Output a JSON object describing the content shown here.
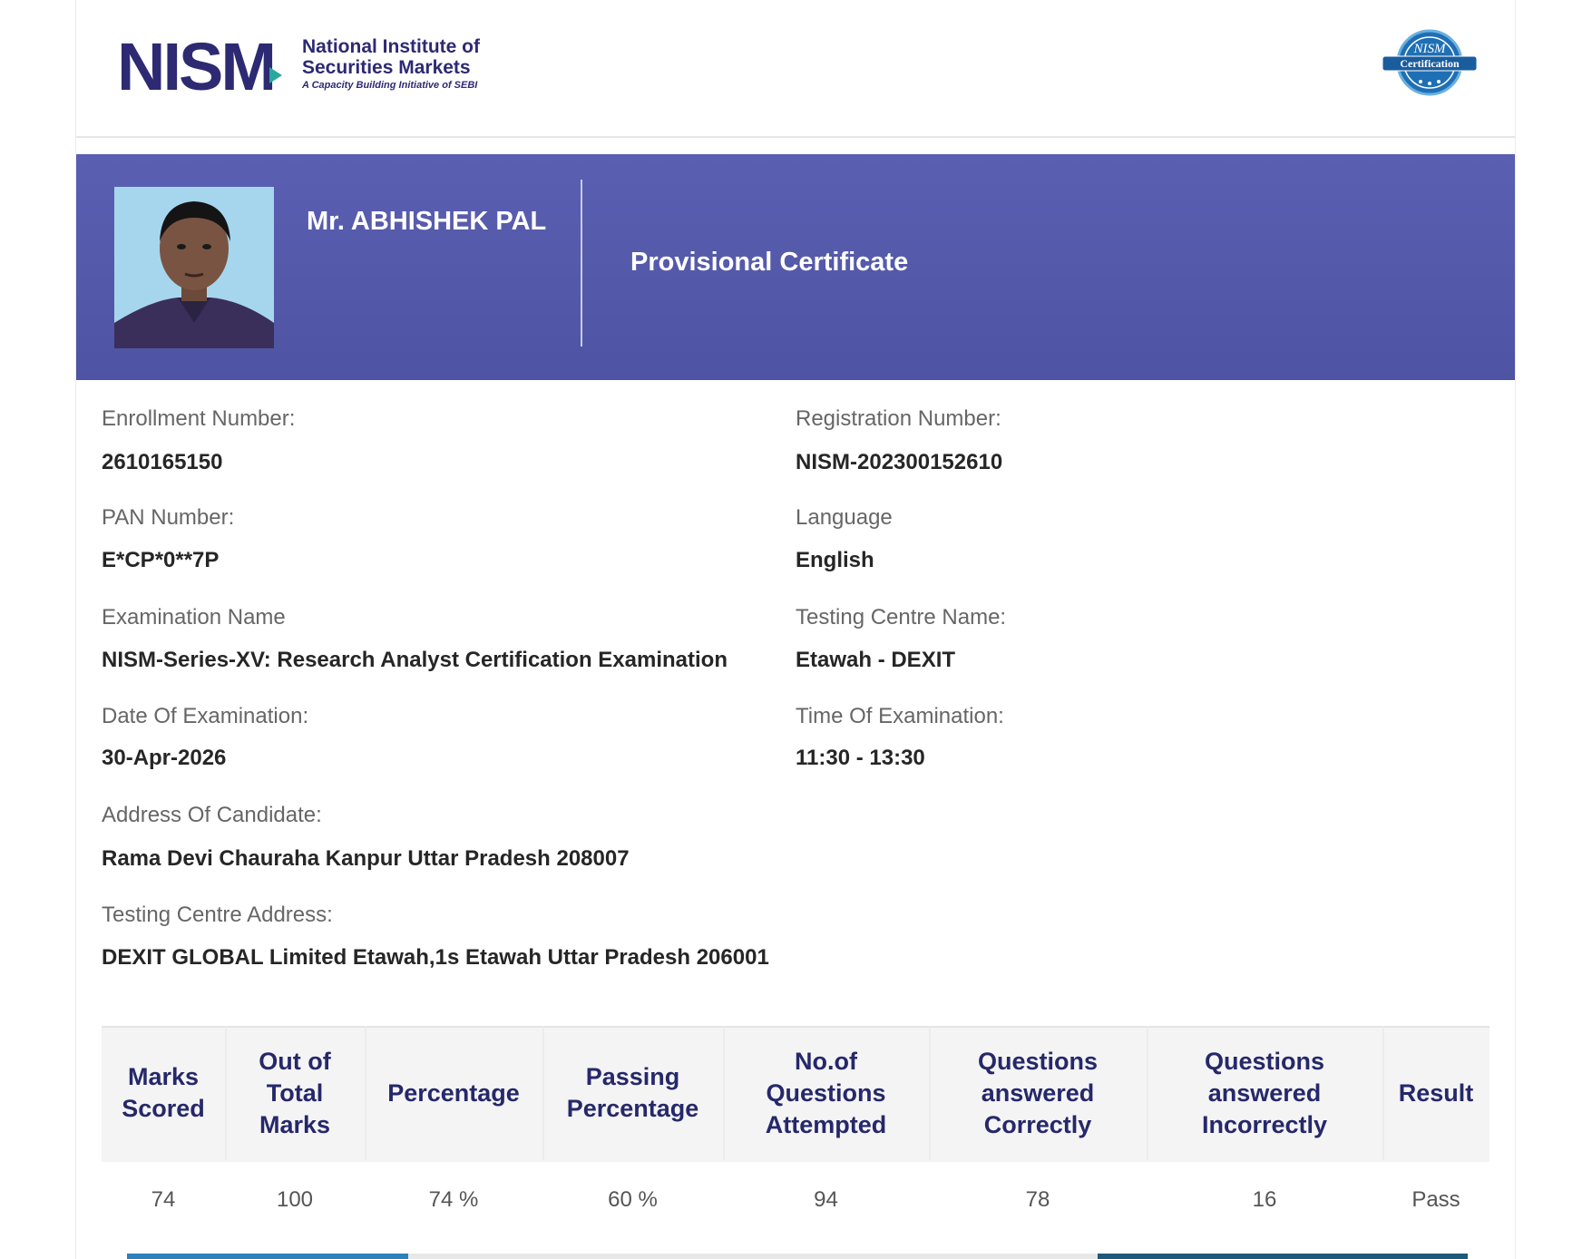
{
  "header": {
    "logo_mark": "NISM",
    "logo_line1": "National Institute of",
    "logo_line2": "Securities Markets",
    "logo_line3": "A Capacity Building Initiative of SEBI",
    "seal_text_top": "NISM",
    "seal_text_bottom": "Certification"
  },
  "banner": {
    "candidate_name": "Mr. ABHISHEK PAL",
    "certificate_title": "Provisional Certificate"
  },
  "fields": {
    "enrollment": {
      "label": "Enrollment Number:",
      "value": "2610165150"
    },
    "registration": {
      "label": "Registration Number:",
      "value": "NISM-202300152610"
    },
    "pan": {
      "label": "PAN Number:",
      "value": "E*CP*0**7P"
    },
    "language": {
      "label": "Language",
      "value": "English"
    },
    "exam_name": {
      "label": "Examination Name",
      "value": "NISM-Series-XV: Research Analyst Certification Examination"
    },
    "centre_name": {
      "label": "Testing Centre Name:",
      "value": "Etawah - DEXIT"
    },
    "exam_date": {
      "label": "Date Of Examination:",
      "value": "30-Apr-2026"
    },
    "exam_time": {
      "label": "Time Of Examination:",
      "value": "11:30 - 13:30"
    },
    "address": {
      "label": "Address Of Candidate:",
      "value": "Rama Devi Chauraha Kanpur Uttar Pradesh 208007"
    },
    "centre_address": {
      "label": "Testing Centre Address:",
      "value": "DEXIT GLOBAL Limited Etawah,1s Etawah Uttar Pradesh 206001"
    }
  },
  "results": {
    "headers": [
      [
        "Marks",
        "Scored"
      ],
      [
        "Out of",
        "Total",
        "Marks"
      ],
      [
        "Percentage"
      ],
      [
        "Passing",
        "Percentage"
      ],
      [
        "No.of",
        "Questions",
        "Attempted"
      ],
      [
        "Questions",
        "answered",
        "Correctly"
      ],
      [
        "Questions",
        "answered",
        "Incorrectly"
      ],
      [
        "Result"
      ]
    ],
    "values": [
      "74",
      "100",
      "74 %",
      "60 %",
      "94",
      "78",
      "16",
      "Pass"
    ]
  },
  "colors": {
    "banner": "#5458a8",
    "brand_navy": "#2d2a73",
    "brand_teal": "#2aa8a0",
    "header_text": "#26286a"
  }
}
